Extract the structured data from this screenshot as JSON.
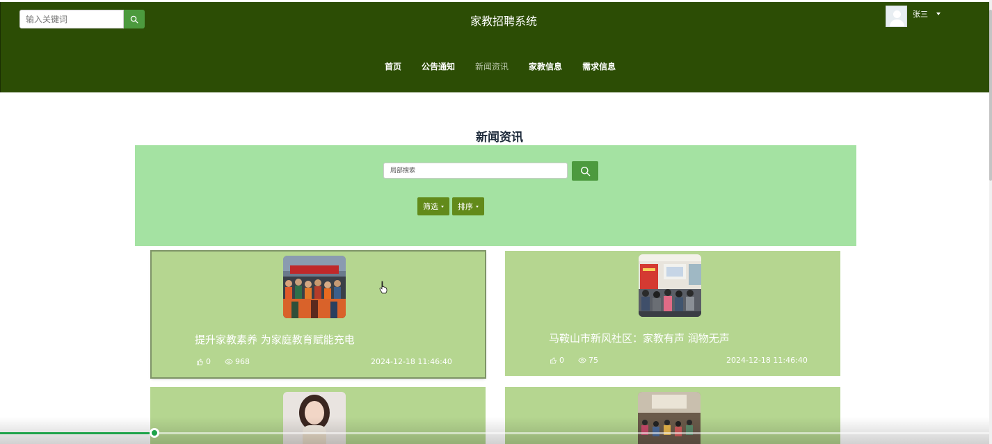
{
  "header": {
    "search_placeholder": "输入关键词",
    "site_title": "家教招聘系统",
    "user_name": "张三",
    "nav": [
      {
        "label": "首页",
        "active": false
      },
      {
        "label": "公告通知",
        "active": false
      },
      {
        "label": "新闻资讯",
        "active": true
      },
      {
        "label": "家教信息",
        "active": false
      },
      {
        "label": "需求信息",
        "active": false
      }
    ]
  },
  "main": {
    "section_title": "新闻资讯",
    "local_search_placeholder": "局部搜索",
    "filter_label": "筛选",
    "sort_label": "排序"
  },
  "news": [
    {
      "title": "提升家教素养 为家庭教育赋能充电",
      "likes": "0",
      "views": "968",
      "date": "2024-12-18 11:46:40"
    },
    {
      "title": "马鞍山市新风社区：家教有声 润物无声",
      "likes": "0",
      "views": "75",
      "date": "2024-12-18 11:46:40"
    },
    {
      "title": "",
      "likes": "",
      "views": "",
      "date": ""
    },
    {
      "title": "",
      "likes": "",
      "views": "",
      "date": ""
    }
  ],
  "video": {
    "progress": 0.156
  },
  "colors": {
    "header_bg": "#2c4d05",
    "accent_green": "#4c9a3e",
    "filter_panel_bg": "#a4e2a2",
    "card_bg": "#b5d690",
    "dropdown_bg": "#628a1a",
    "progress_green": "#1ea34a"
  }
}
